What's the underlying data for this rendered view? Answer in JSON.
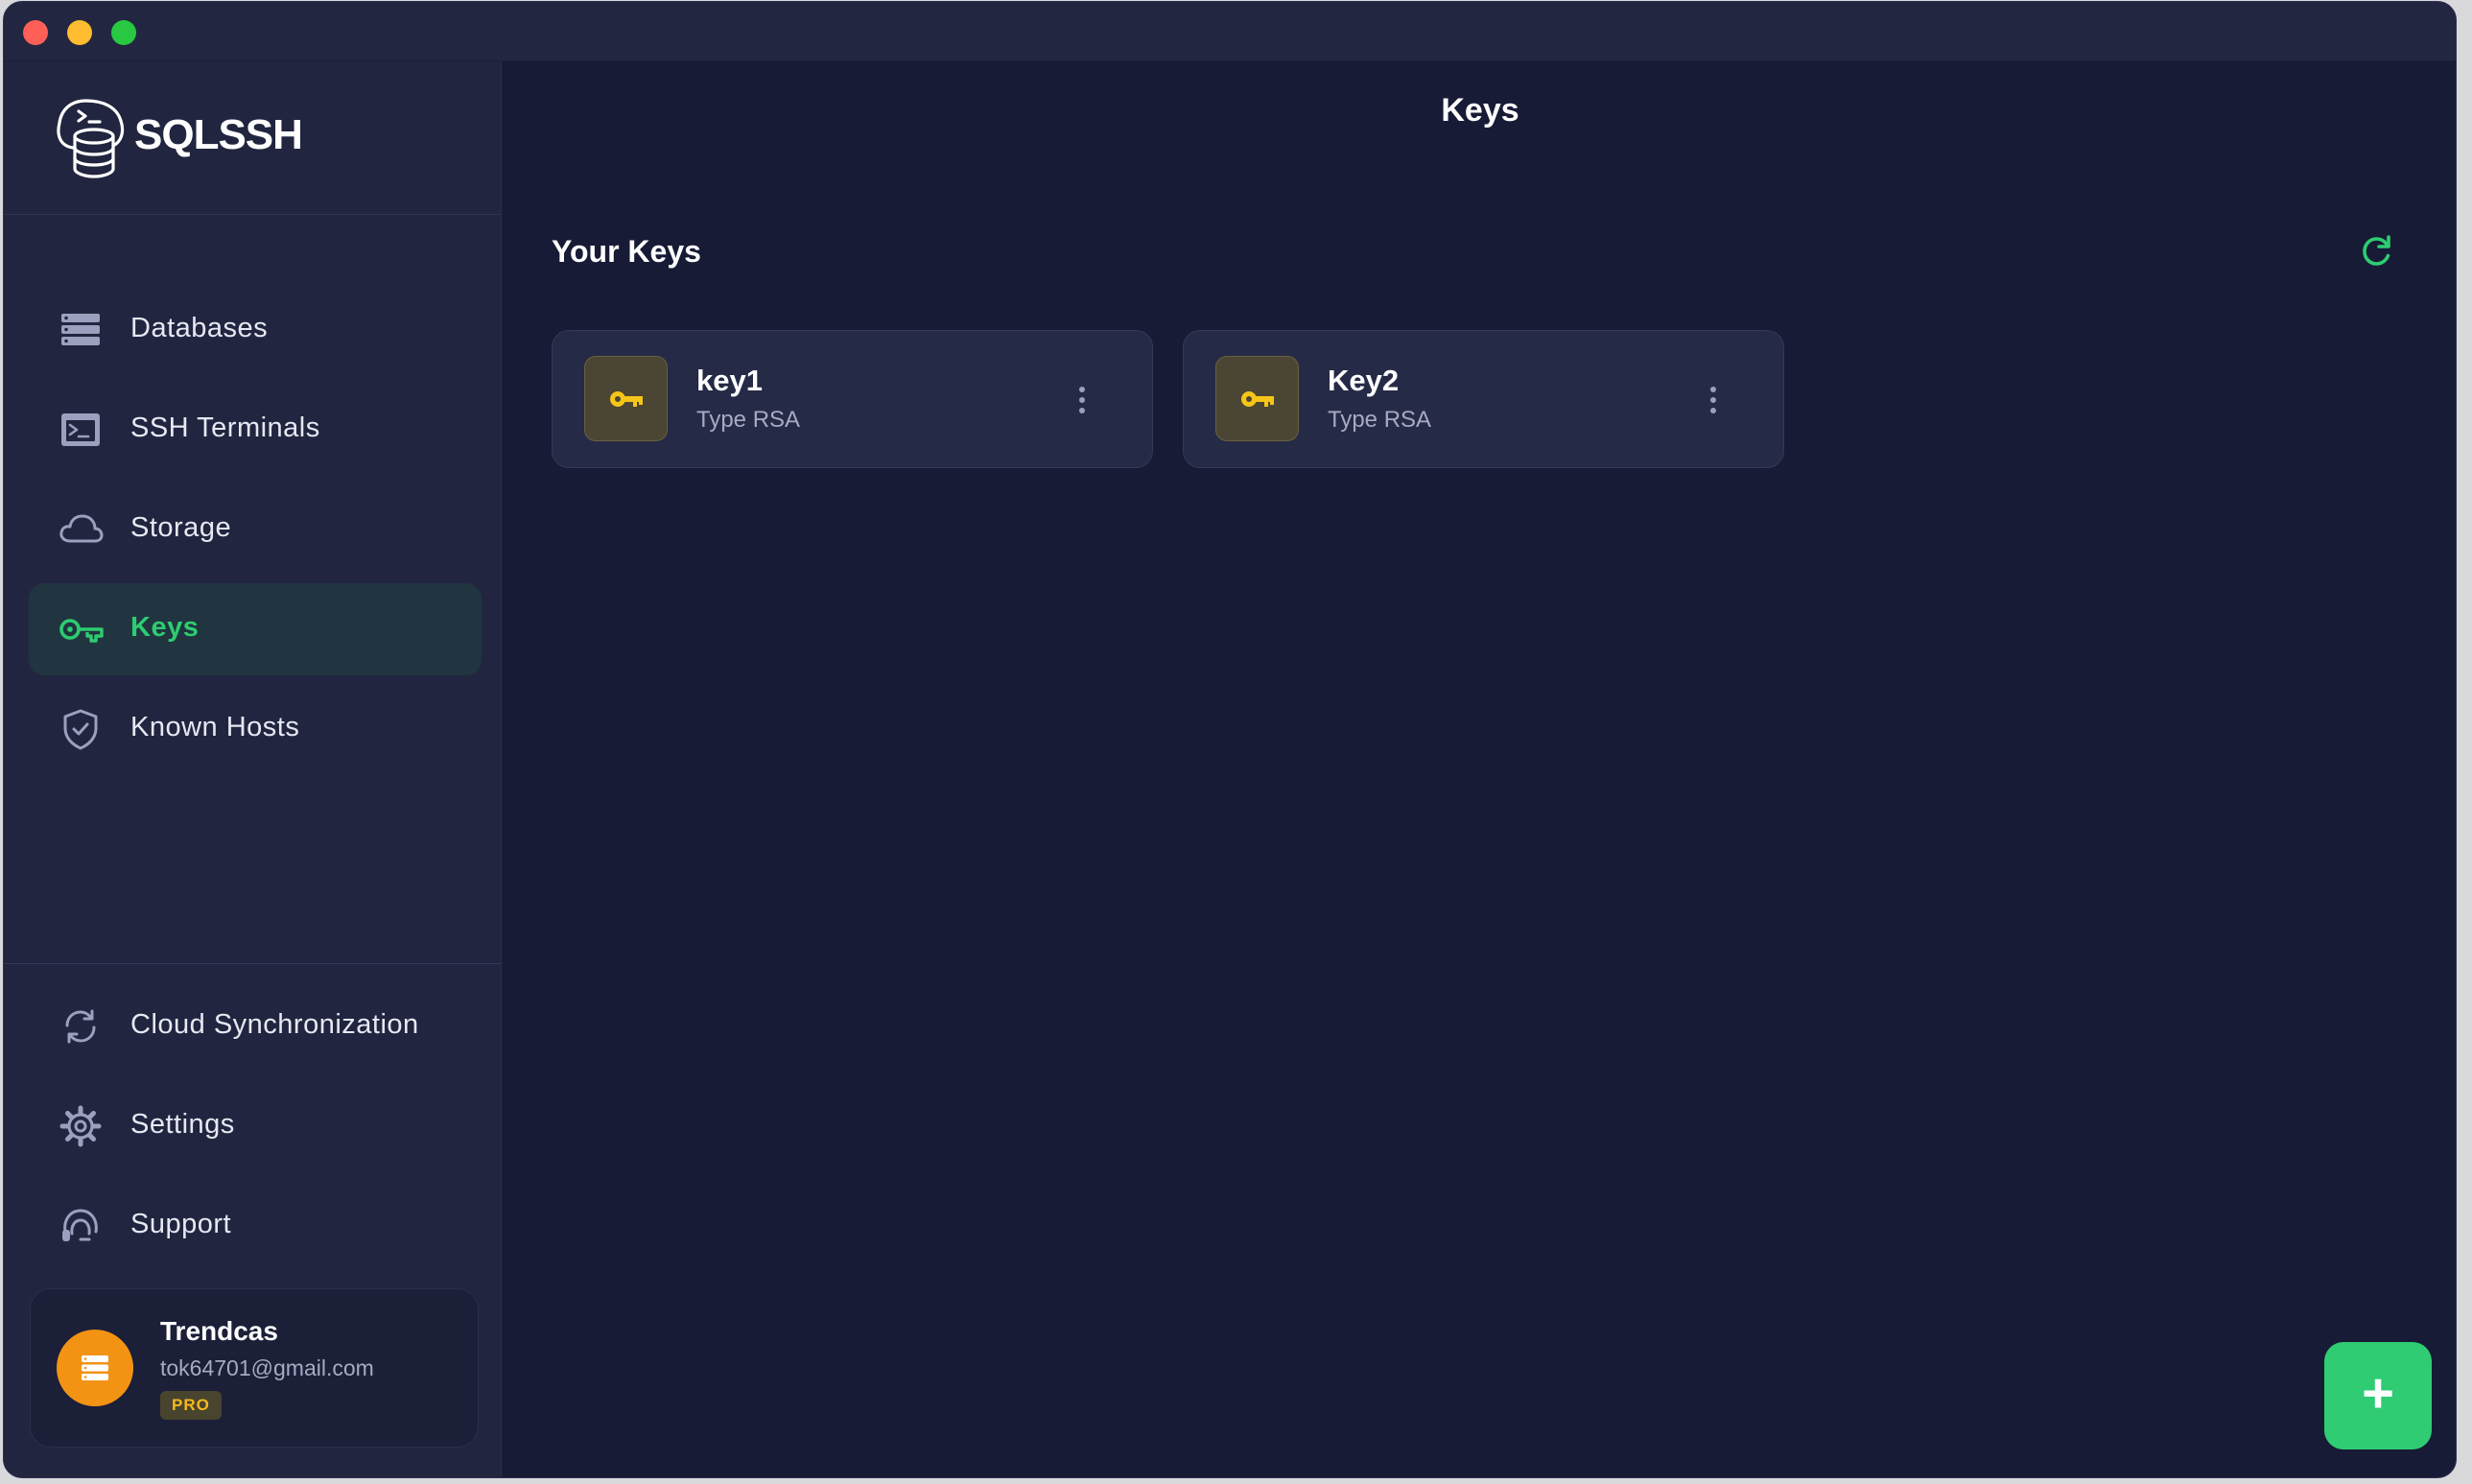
{
  "app": {
    "name": "SQLSSH"
  },
  "header": {
    "title": "Keys"
  },
  "sidebar": {
    "items": [
      {
        "label": "Databases",
        "icon": "database-icon"
      },
      {
        "label": "SSH Terminals",
        "icon": "terminal-icon"
      },
      {
        "label": "Storage",
        "icon": "cloud-icon"
      },
      {
        "label": "Keys",
        "icon": "key-icon",
        "active": true
      },
      {
        "label": "Known Hosts",
        "icon": "shield-check-icon"
      }
    ],
    "bottom_items": [
      {
        "label": "Cloud Synchronization",
        "icon": "sync-icon"
      },
      {
        "label": "Settings",
        "icon": "gear-icon"
      },
      {
        "label": "Support",
        "icon": "headset-icon"
      }
    ]
  },
  "user": {
    "name": "Trendcas",
    "email": "tok64701@gmail.com",
    "badge": "PRO"
  },
  "main": {
    "section_title": "Your Keys",
    "keys": [
      {
        "name": "key1",
        "type": "Type RSA"
      },
      {
        "name": "Key2",
        "type": "Type RSA"
      }
    ],
    "add_button": "+"
  },
  "colors": {
    "accent": "#2ecc71",
    "background": "#171b35",
    "sidebar": "#21253f",
    "key_icon": "#f5c518",
    "avatar": "#f39314"
  }
}
